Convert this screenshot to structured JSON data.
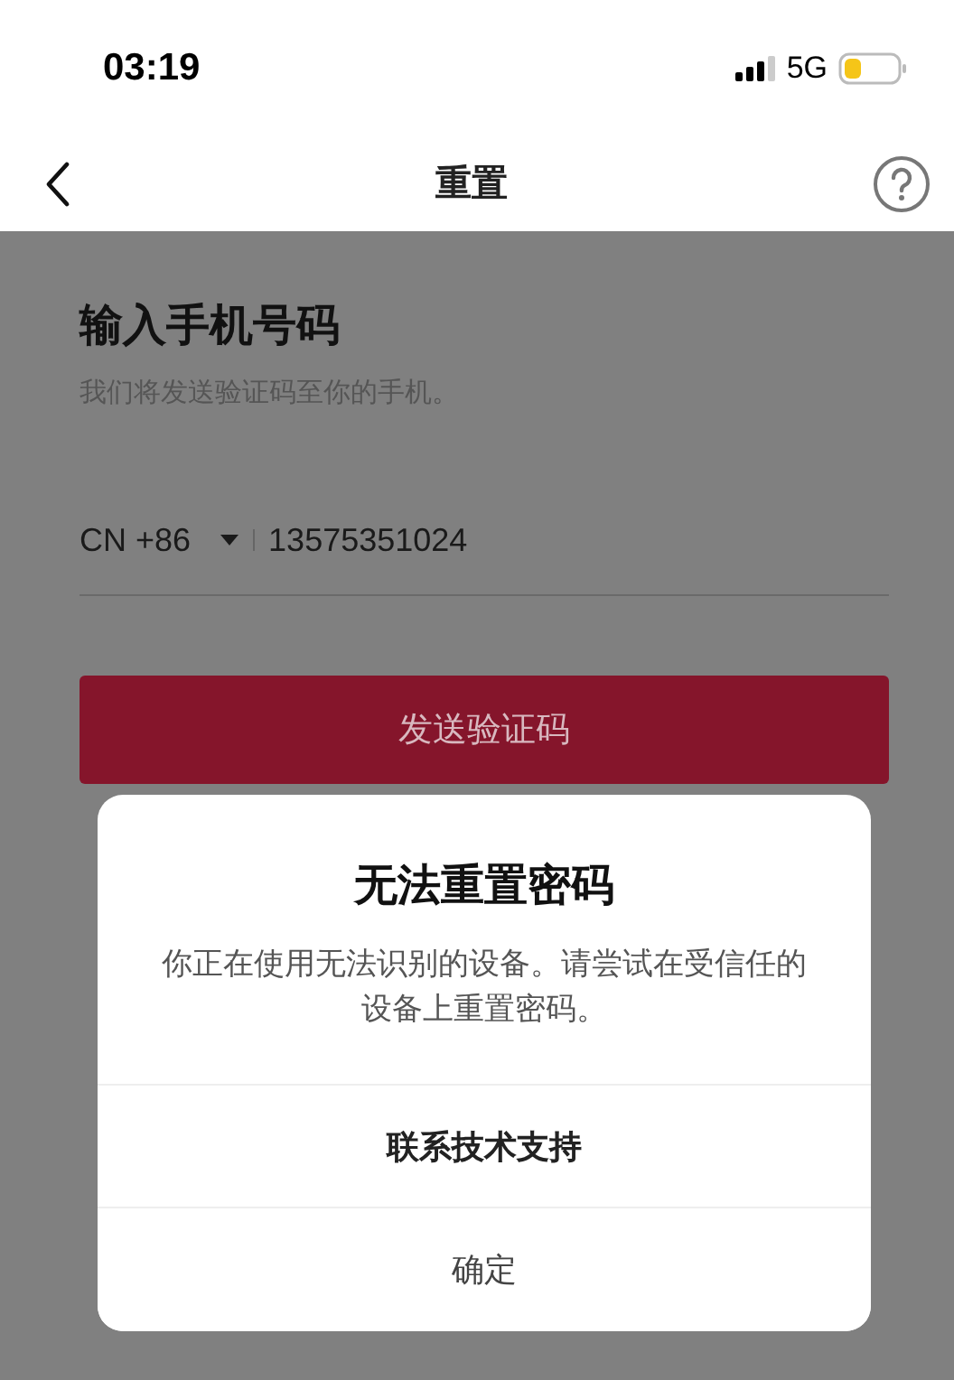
{
  "status_bar": {
    "time": "03:19",
    "network": "5G"
  },
  "nav": {
    "title": "重置"
  },
  "form": {
    "heading": "输入手机号码",
    "subtitle": "我们将发送验证码至你的手机。",
    "country_code": "CN +86",
    "phone": "13575351024",
    "submit": "发送验证码"
  },
  "dialog": {
    "title": "无法重置密码",
    "message": "你正在使用无法识别的设备。请尝试在受信任的设备上重置密码。",
    "buttons": [
      {
        "label": "联系技术支持",
        "kind": "primary"
      },
      {
        "label": "确定",
        "kind": "secondary"
      }
    ]
  }
}
